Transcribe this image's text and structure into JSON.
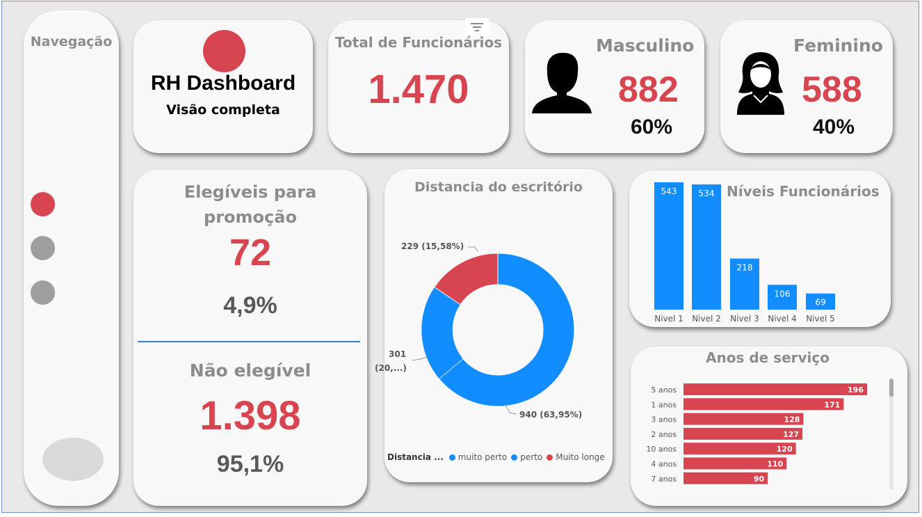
{
  "nav": {
    "title": "Navegação",
    "dots": [
      {
        "name": "nav-page-1",
        "color": "#d64550",
        "active": true
      },
      {
        "name": "nav-page-2",
        "color": "#9e9e9e",
        "active": false
      },
      {
        "name": "nav-page-3",
        "color": "#9e9e9e",
        "active": false
      }
    ]
  },
  "brand": {
    "title": "RH Dashboard",
    "subtitle": "Visão completa",
    "logo_color": "#d64550"
  },
  "total": {
    "title": "Total de Funcionários",
    "value": "1.470",
    "filter_icon": "filter-icon"
  },
  "masculino": {
    "title": "Masculino",
    "value": "882",
    "percent": "60%",
    "icon": "male-person-icon"
  },
  "feminino": {
    "title": "Feminino",
    "value": "588",
    "percent": "40%",
    "icon": "female-person-icon"
  },
  "elegiveis": {
    "title_line1": "Elegíveis para",
    "title_line2": "promoção",
    "value": "72",
    "percent": "4,9%"
  },
  "nao_elegivel": {
    "title": "Não elegível",
    "value": "1.398",
    "percent": "95,1%"
  },
  "distancia": {
    "title": "Distancia do escritório",
    "labels": {
      "muito_longe": "229 (15,58%)",
      "perto_line1": "301",
      "perto_line2": "(20,...)",
      "muito_perto": "940 (63,95%)"
    },
    "legend_title": "Distancia ...",
    "legend": [
      {
        "label": "muito perto",
        "color": "#118dff"
      },
      {
        "label": "perto",
        "color": "#118dff"
      },
      {
        "label": "Muito longe",
        "color": "#d64550"
      }
    ]
  },
  "niveis": {
    "title": "Níveis Funcionários"
  },
  "anos": {
    "title": "Anos de serviço"
  },
  "chart_data": [
    {
      "type": "pie",
      "title": "Distancia do escritório",
      "categories": [
        "muito perto",
        "perto",
        "Muito longe"
      ],
      "values": [
        940,
        301,
        229
      ],
      "colors": [
        "#118dff",
        "#118dff",
        "#d64550"
      ]
    },
    {
      "type": "bar",
      "title": "Níveis Funcionários",
      "categories": [
        "Nivel 1",
        "Nivel 2",
        "Nivel 3",
        "Nivel 4",
        "Nivel 5"
      ],
      "values": [
        543,
        534,
        218,
        106,
        69
      ],
      "color": "#118dff"
    },
    {
      "type": "bar",
      "orientation": "horizontal",
      "title": "Anos de serviço",
      "categories": [
        "5 anos",
        "1 anos",
        "3 anos",
        "2 anos",
        "10 anos",
        "4 anos",
        "7 anos"
      ],
      "values": [
        196,
        171,
        128,
        127,
        120,
        110,
        90
      ],
      "color": "#d64550"
    }
  ]
}
